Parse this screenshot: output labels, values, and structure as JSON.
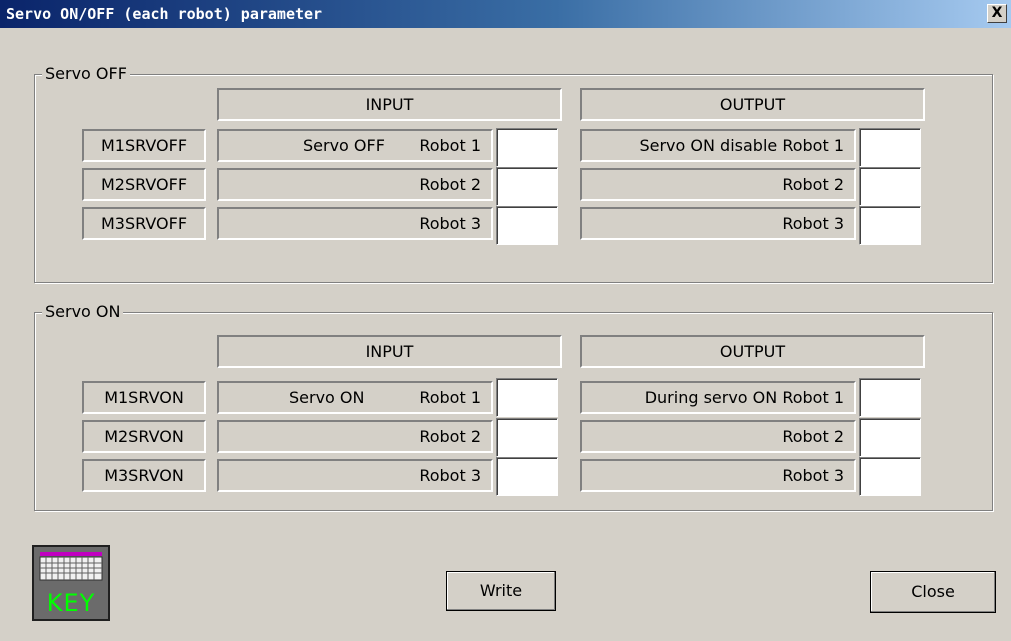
{
  "window": {
    "title": "Servo ON/OFF (each robot) parameter",
    "close_glyph": "X"
  },
  "servo_off": {
    "group_label": "Servo OFF",
    "input_header": "INPUT",
    "output_header": "OUTPUT",
    "rows": [
      {
        "code": "M1SRVOFF",
        "input_prefix": "Servo OFF",
        "input_label": "Robot 1",
        "input_value": "",
        "output_prefix": "Servo ON disable",
        "output_label": "Robot 1",
        "output_value": ""
      },
      {
        "code": "M2SRVOFF",
        "input_prefix": "",
        "input_label": "Robot 2",
        "input_value": "",
        "output_prefix": "",
        "output_label": "Robot 2",
        "output_value": ""
      },
      {
        "code": "M3SRVOFF",
        "input_prefix": "",
        "input_label": "Robot 3",
        "input_value": "",
        "output_prefix": "",
        "output_label": "Robot 3",
        "output_value": ""
      }
    ]
  },
  "servo_on": {
    "group_label": "Servo ON",
    "input_header": "INPUT",
    "output_header": "OUTPUT",
    "rows": [
      {
        "code": "M1SRVON",
        "input_prefix": "Servo ON",
        "input_label": "Robot 1",
        "input_value": "",
        "output_prefix": "During servo ON",
        "output_label": "Robot 1",
        "output_value": ""
      },
      {
        "code": "M2SRVON",
        "input_prefix": "",
        "input_label": "Robot 2",
        "input_value": "",
        "output_prefix": "",
        "output_label": "Robot 2",
        "output_value": ""
      },
      {
        "code": "M3SRVON",
        "input_prefix": "",
        "input_label": "Robot 3",
        "input_value": "",
        "output_prefix": "",
        "output_label": "Robot 3",
        "output_value": ""
      }
    ]
  },
  "footer": {
    "key_label": "KEY",
    "write_label": "Write",
    "close_label": "Close"
  },
  "icons": {
    "keyboard": "keyboard-icon"
  },
  "colors": {
    "titlebar_start": "#0a246a",
    "titlebar_end": "#a6caf0",
    "dialog_bg": "#d4d0c8",
    "key_text": "#00ff00"
  }
}
